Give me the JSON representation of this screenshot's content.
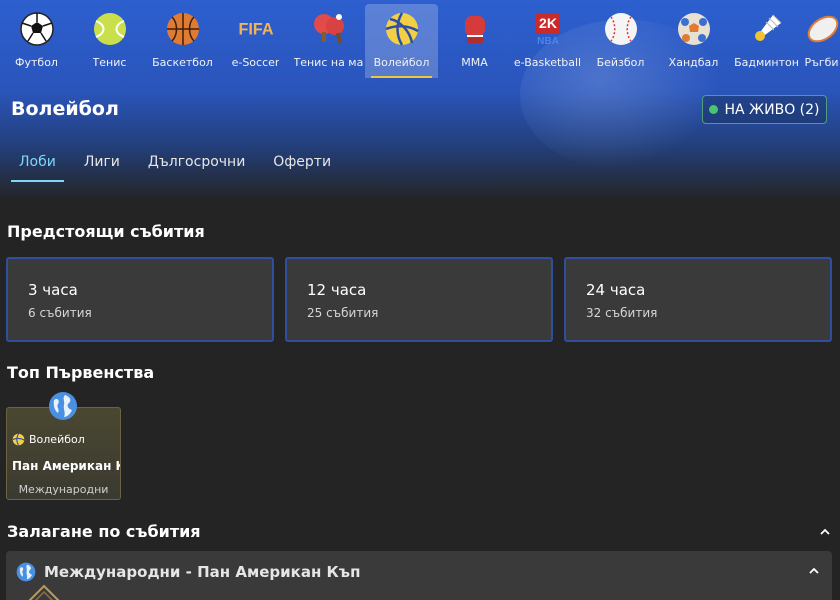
{
  "sports": [
    {
      "label": "Футбол",
      "icon": "soccer-ball-icon"
    },
    {
      "label": "Тенис",
      "icon": "tennis-ball-icon"
    },
    {
      "label": "Баскетбол",
      "icon": "basketball-icon"
    },
    {
      "label": "e-Soccer",
      "icon": "fifa-icon"
    },
    {
      "label": "Тенис на маса",
      "icon": "table-tennis-icon"
    },
    {
      "label": "Волейбол",
      "icon": "volleyball-icon",
      "active": true
    },
    {
      "label": "MMA",
      "icon": "boxing-glove-icon"
    },
    {
      "label": "e-Basketball",
      "icon": "nba2k-icon"
    },
    {
      "label": "Бейзбол",
      "icon": "baseball-icon"
    },
    {
      "label": "Хандбал",
      "icon": "handball-icon"
    },
    {
      "label": "Бадминтон",
      "icon": "shuttlecock-icon"
    },
    {
      "label": "Ръгби",
      "icon": "rugby-icon"
    }
  ],
  "header": {
    "title": "Волейбол",
    "live_label": "НА ЖИВО (2)"
  },
  "tabs": [
    {
      "label": "Лоби",
      "active": true
    },
    {
      "label": "Лиги"
    },
    {
      "label": "Дългосрочни"
    },
    {
      "label": "Оферти"
    }
  ],
  "upcoming": {
    "title": "Предстоящи събития",
    "cards": [
      {
        "time": "3 часа",
        "count": "6 събития"
      },
      {
        "time": "12 часа",
        "count": "25 събития"
      },
      {
        "time": "24 часа",
        "count": "32 събития"
      }
    ]
  },
  "top_leagues": {
    "title": "Топ Първенства",
    "cards": [
      {
        "sport": "Волейбол",
        "name": "Пан Американ Къп",
        "country": "Международни"
      }
    ]
  },
  "event_betting": {
    "title": "Залагане по събития",
    "group_title": "Международни - Пан Американ Къп"
  },
  "colors": {
    "accent_tab": "#7fd6f5",
    "live_dot": "#4cc46e",
    "card_border": "#2f4e9e",
    "hero_blue": "#2d5fcf"
  }
}
